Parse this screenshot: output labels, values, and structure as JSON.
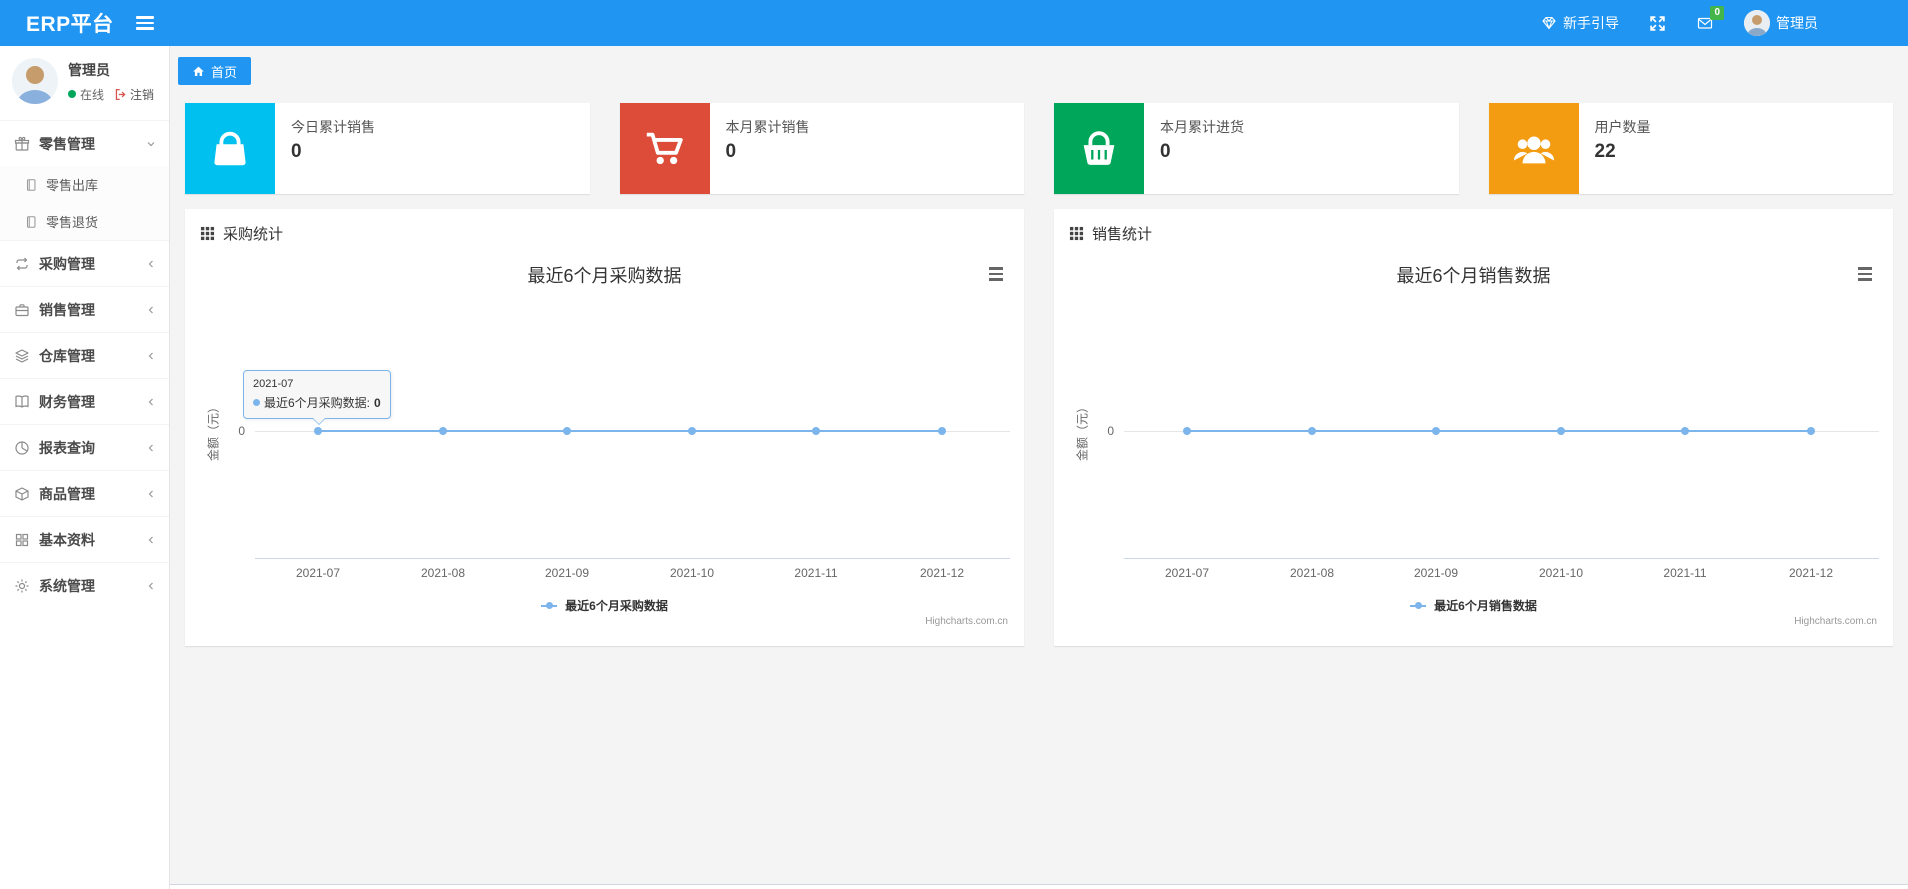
{
  "navbar": {
    "brand": "ERP平台",
    "guide_label": "新手引导",
    "messages_badge": "0",
    "user_name": "管理员",
    "accent_color": "#2095f2"
  },
  "sidebar": {
    "user": {
      "name": "管理员",
      "status_online": "在线",
      "logout_label": "注销"
    },
    "items": [
      {
        "label": "零售管理",
        "icon": "gift-icon",
        "state": "expanded",
        "children": [
          {
            "label": "零售出库",
            "icon": "document-icon"
          },
          {
            "label": "零售退货",
            "icon": "document-icon"
          }
        ]
      },
      {
        "label": "采购管理",
        "icon": "repeat-icon",
        "state": "collapsed"
      },
      {
        "label": "销售管理",
        "icon": "briefcase-icon",
        "state": "collapsed"
      },
      {
        "label": "仓库管理",
        "icon": "layers-icon",
        "state": "collapsed"
      },
      {
        "label": "财务管理",
        "icon": "book-icon",
        "state": "collapsed"
      },
      {
        "label": "报表查询",
        "icon": "pie-chart-icon",
        "state": "collapsed"
      },
      {
        "label": "商品管理",
        "icon": "package-icon",
        "state": "collapsed"
      },
      {
        "label": "基本资料",
        "icon": "grid-icon",
        "state": "collapsed"
      },
      {
        "label": "系统管理",
        "icon": "gear-icon",
        "state": "collapsed"
      }
    ]
  },
  "tabs": {
    "home": "首页"
  },
  "stat_cards": [
    {
      "title": "今日累计销售",
      "value": "0",
      "icon": "shopping-bag-icon",
      "color": "#00c0ef"
    },
    {
      "title": "本月累计销售",
      "value": "0",
      "icon": "shopping-cart-icon",
      "color": "#dd4b39"
    },
    {
      "title": "本月累计进货",
      "value": "0",
      "icon": "shopping-basket-icon",
      "color": "#00a65a"
    },
    {
      "title": "用户数量",
      "value": "22",
      "icon": "users-icon",
      "color": "#f39c12"
    }
  ],
  "panels": [
    {
      "header": "采购统计"
    },
    {
      "header": "销售统计"
    }
  ],
  "chart_data": [
    {
      "type": "line",
      "title": "最近6个月采购数据",
      "categories": [
        "2021-07",
        "2021-08",
        "2021-09",
        "2021-10",
        "2021-11",
        "2021-12"
      ],
      "series": [
        {
          "name": "最近6个月采购数据",
          "values": [
            0,
            0,
            0,
            0,
            0,
            0
          ]
        }
      ],
      "xlabel": "",
      "ylabel": "金额（元）",
      "yticks": [
        "0"
      ],
      "ylim": [
        0,
        null
      ],
      "grid": "zero line only",
      "legend_position": "bottom-center",
      "line_color": "#7cb5ec",
      "credit": "Highcharts.com.cn",
      "tooltip": {
        "header": "2021-07",
        "label": "最近6个月采购数据:",
        "value": "0"
      }
    },
    {
      "type": "line",
      "title": "最近6个月销售数据",
      "categories": [
        "2021-07",
        "2021-08",
        "2021-09",
        "2021-10",
        "2021-11",
        "2021-12"
      ],
      "series": [
        {
          "name": "最近6个月销售数据",
          "values": [
            0,
            0,
            0,
            0,
            0,
            0
          ]
        }
      ],
      "xlabel": "",
      "ylabel": "金额（元）",
      "yticks": [
        "0"
      ],
      "ylim": [
        0,
        null
      ],
      "grid": "zero line only",
      "legend_position": "bottom-center",
      "line_color": "#7cb5ec",
      "credit": "Highcharts.com.cn"
    }
  ]
}
